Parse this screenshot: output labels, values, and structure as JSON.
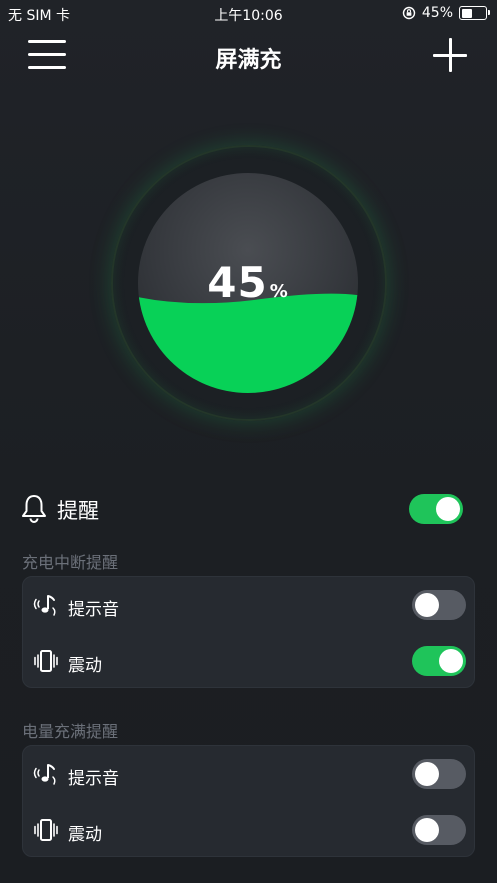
{
  "status_bar": {
    "carrier": "无 SIM 卡",
    "time": "上午10:06",
    "battery_text": "45%",
    "battery_level": 0.45
  },
  "header": {
    "title": "屏满充",
    "menu_icon": "hamburger-menu-icon",
    "add_icon": "plus-icon"
  },
  "gauge": {
    "value": "45",
    "unit": "%",
    "level": 0.45,
    "fill_color": "#08d157"
  },
  "reminder": {
    "label": "提醒",
    "icon": "bell-icon",
    "enabled": true
  },
  "sections": [
    {
      "title": "充电中断提醒",
      "items": [
        {
          "label": "提示音",
          "icon": "music-note-icon",
          "enabled": false
        },
        {
          "label": "震动",
          "icon": "vibrate-icon",
          "enabled": true
        }
      ]
    },
    {
      "title": "电量充满提醒",
      "items": [
        {
          "label": "提示音",
          "icon": "music-note-icon",
          "enabled": false
        },
        {
          "label": "震动",
          "icon": "vibrate-icon",
          "enabled": false
        }
      ]
    }
  ],
  "colors": {
    "accent_green": "#1fc45a",
    "toggle_off": "#575b63",
    "section_title": "#6b7079"
  }
}
